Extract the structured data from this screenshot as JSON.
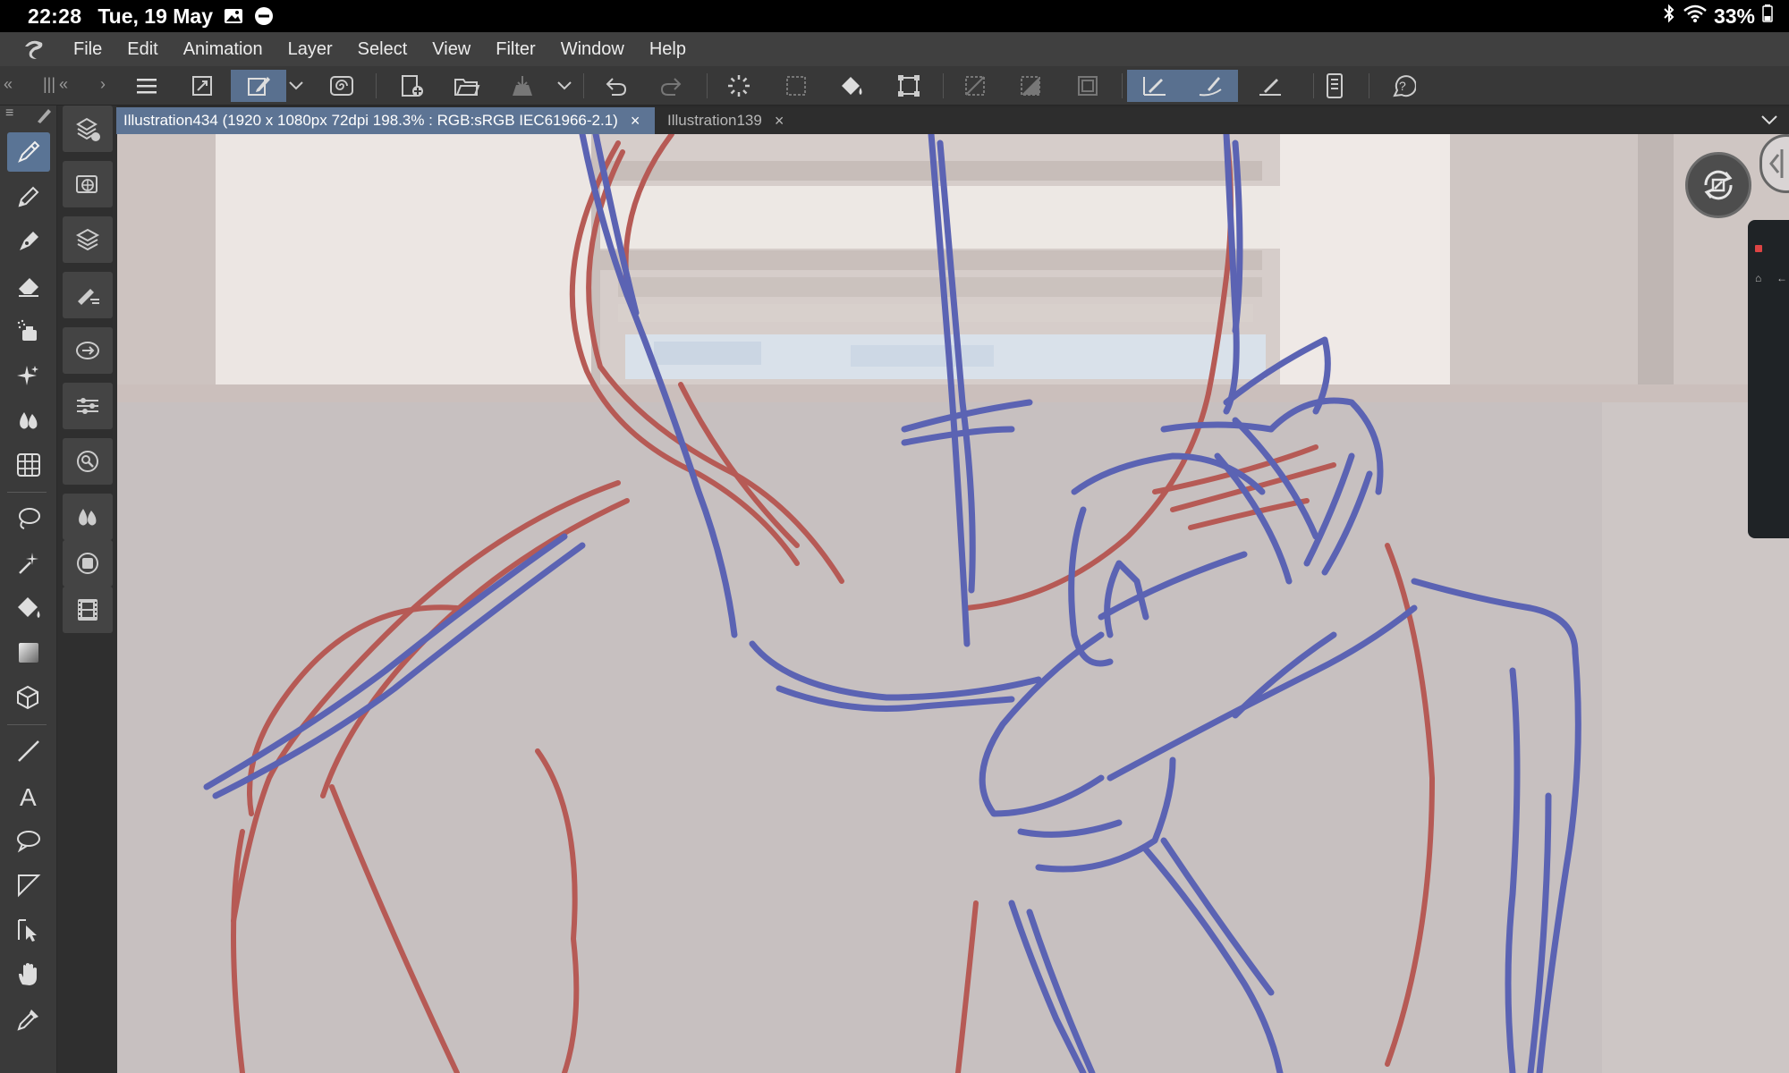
{
  "status": {
    "time": "22:28",
    "date": "Tue, 19 May",
    "battery": "33%"
  },
  "menu": {
    "items": [
      "File",
      "Edit",
      "Animation",
      "Layer",
      "Select",
      "View",
      "Filter",
      "Window",
      "Help"
    ]
  },
  "tabs": [
    {
      "label": "Illustration434 (1920 x 1080px 72dpi 198.3% : RGB:sRGB IEC61966-2.1)",
      "close": "×",
      "active": true
    },
    {
      "label": "Illustration139",
      "close": "×",
      "active": false
    }
  ],
  "command_bar": {
    "icons": [
      "hamburger-menu-icon",
      "fit-view-icon",
      "edit-mode-icon",
      "dropdown-arrow-icon",
      "spiral-icon",
      "new-canvas-icon",
      "open-folder-icon",
      "save-icon",
      "dropdown-arrow-icon",
      "undo-icon",
      "redo-icon",
      "loading-icon",
      "deselect-icon",
      "fill-icon",
      "transform-icon",
      "clear-icon",
      "fill-gray-icon",
      "frame-icon",
      "pen-stabilize-icon",
      "brush-stabilize-icon",
      "ruler-pen-icon",
      "device-icon",
      "help-icon"
    ]
  },
  "tools": [
    "pen-icon",
    "pencil-icon",
    "ink-pen-icon",
    "eraser-icon",
    "airbrush-icon",
    "sparkle-icon",
    "blend-icon",
    "grid-icon",
    "lasso-icon",
    "magic-wand-icon",
    "fill-bucket-icon",
    "gradient-icon",
    "3d-cube-icon",
    "line-icon",
    "text-icon",
    "balloon-icon",
    "frame-border-icon",
    "move-icon",
    "hand-icon",
    "eyedropper-icon"
  ],
  "sub_tools": [
    "sub-tool-icon",
    "layers-globe-icon",
    "layer-stack-icon",
    "brush-settings-icon",
    "navigator-icon",
    "adjust-icon",
    "search-icon",
    "drops-icon",
    "color-circle-icon",
    "film-icon"
  ],
  "colors": {
    "sketch_red": "#b65a55",
    "sketch_blue": "#5b63b3",
    "accent": "#5a7495"
  }
}
